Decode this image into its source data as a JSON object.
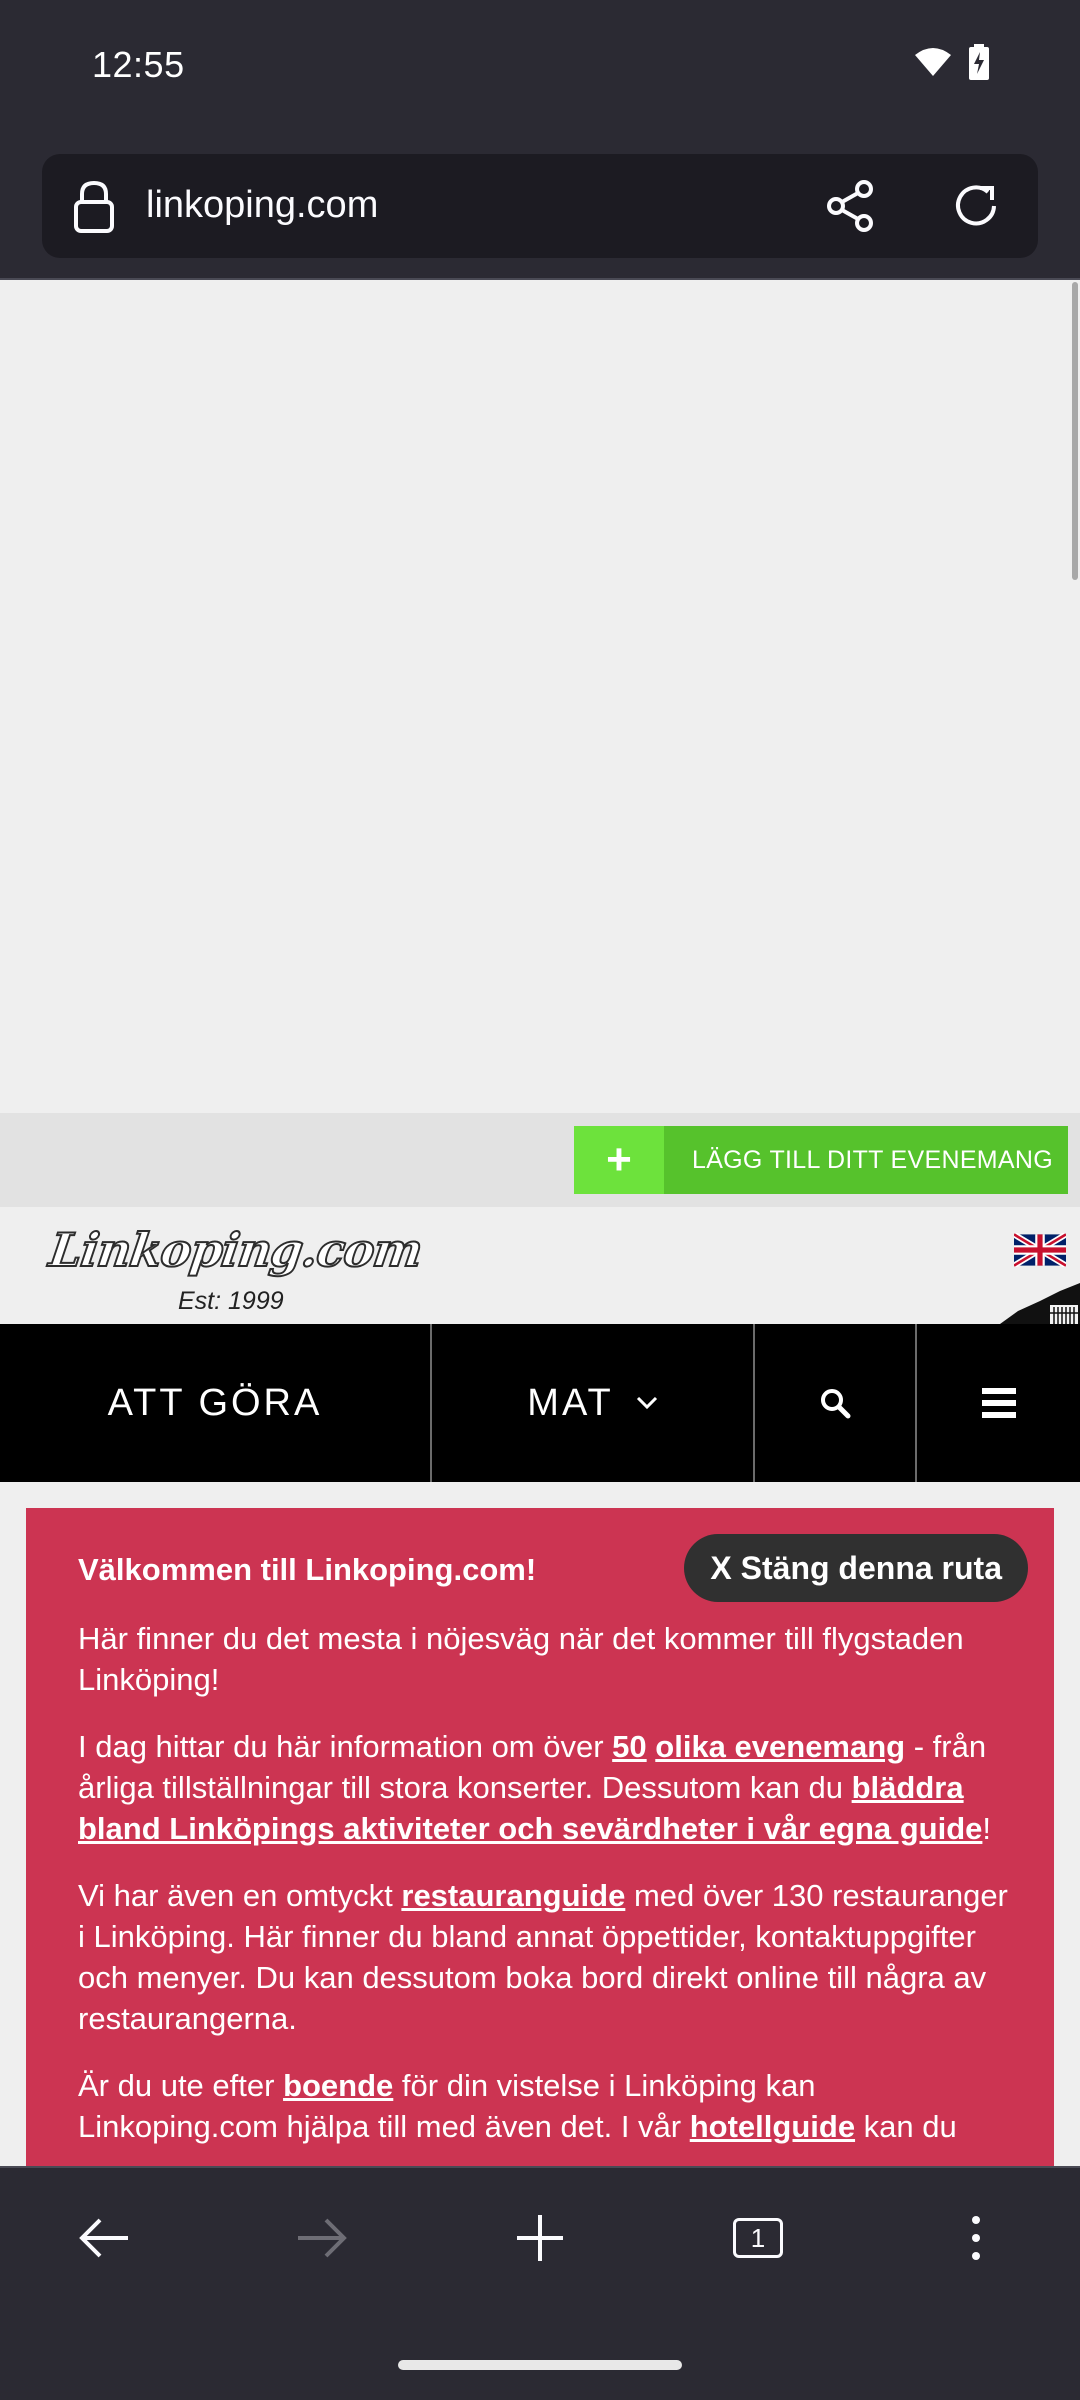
{
  "status_bar": {
    "time": "12:55",
    "icons": [
      "wifi-icon",
      "battery-charging-icon"
    ]
  },
  "browser": {
    "url": "linkoping.com",
    "icons": [
      "lock-icon",
      "share-icon",
      "reload-icon"
    ]
  },
  "page": {
    "event_button": {
      "icon": "+",
      "label": "LÄGG TILL DITT EVENEMANG"
    },
    "logo": {
      "text": "Linkoping.com",
      "tagline": "Est: 1999"
    },
    "nav": {
      "items": [
        "ATT GÖRA",
        "MAT"
      ],
      "icons": [
        "search-icon",
        "hamburger-menu-icon"
      ]
    },
    "welcome": {
      "title": "Välkommen till Linkoping.com!",
      "close_label": "X Stäng denna ruta",
      "p1": "Här finner du det mesta i nöjesväg när det kommer till flygstaden Linköping!",
      "p2_a": "I dag hittar du här information om över ",
      "p2_link1": "50",
      "p2_link2": "olika evenemang",
      "p2_b": " - från årliga tillställningar till stora konserter. Dessutom kan du ",
      "p2_link3": "bläddra bland Linköpings aktiviteter och sevärdheter i vår egna guide",
      "p2_c": "!",
      "p3_a": "Vi har även en omtyckt ",
      "p3_link": "restauranguide",
      "p3_b": " med över 130 restauranger i Linköping. Här finner du bland annat öppettider, kontaktuppgifter och menyer. Du kan dessutom boka bord direkt online till några av restaurangerna.",
      "p4_a": "Är du ute efter ",
      "p4_link1": "boende",
      "p4_b": " för din vistelse i Linköping kan Linkoping.com hjälpa till med även det. I vår ",
      "p4_link2": "hotellguide",
      "p4_c": " kan du"
    }
  },
  "toolbar": {
    "tab_count": "1",
    "icons": [
      "back-arrow-icon",
      "forward-arrow-icon",
      "new-tab-icon",
      "tabs-icon",
      "more-menu-icon"
    ]
  },
  "colors": {
    "browser_chrome": "#2b2a33",
    "url_field": "#1c1b22",
    "event_green": "#56c22c",
    "welcome_red": "#cc3452",
    "nav_black": "#000000"
  }
}
